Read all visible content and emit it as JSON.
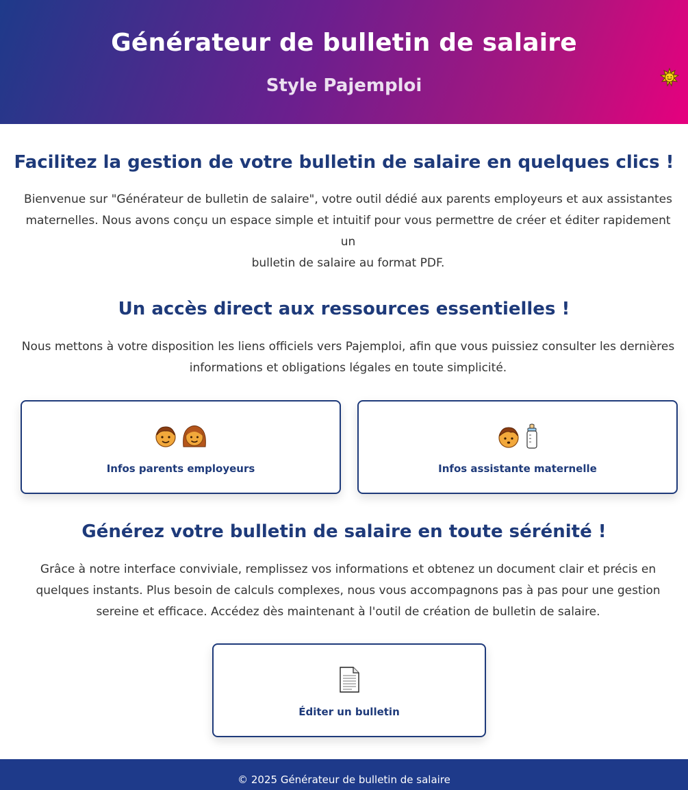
{
  "header": {
    "title": "Générateur de bulletin de salaire",
    "subtitle": "Style Pajemploi",
    "theme_icon": "sun-icon"
  },
  "intro": {
    "title": "Facilitez la gestion de votre bulletin de salaire en quelques clics !",
    "line1": "Bienvenue sur \"Générateur de bulletin de salaire\", votre outil dédié aux parents employeurs et aux assistantes",
    "line2": "maternelles. Nous avons conçu un espace simple et intuitif pour vous permettre de créer et éditer rapidement un",
    "line3": "bulletin de salaire au format PDF."
  },
  "resources": {
    "title": "Un accès direct aux ressources essentielles !",
    "line1": "Nous mettons à votre disposition les liens officiels vers Pajemploi, afin que vous puissiez consulter les dernières",
    "line2": "informations et obligations légales en toute simplicité.",
    "cards": [
      {
        "label": "Infos parents employeurs",
        "icons": [
          "man-icon",
          "woman-icon"
        ]
      },
      {
        "label": "Infos assistante maternelle",
        "icons": [
          "baby-icon",
          "baby-bottle-icon"
        ]
      }
    ]
  },
  "generate": {
    "title": "Générez votre bulletin de salaire en toute sérénité !",
    "line1": "Grâce à notre interface conviviale, remplissez vos informations et obtenez un document clair et précis en",
    "line2": "quelques instants. Plus besoin de calculs complexes, nous vous accompagnons pas à pas pour une gestion",
    "line3": "sereine et efficace. Accédez dès maintenant à l'outil de création de bulletin de salaire.",
    "card": {
      "label": "Éditer un bulletin",
      "icon": "document-icon"
    }
  },
  "footer": {
    "text": "© 2025 Générateur de bulletin de salaire"
  },
  "colors": {
    "primary": "#1e3a7a",
    "footer": "#1e3a8a",
    "gradient_start": "#1e3a8a",
    "gradient_end": "#e6007e"
  }
}
